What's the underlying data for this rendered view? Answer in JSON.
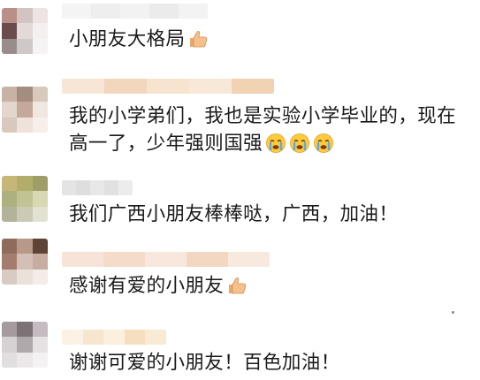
{
  "comments": [
    {
      "text": "小朋友大格局",
      "emoji": "thumbs-up-icon",
      "avatar_colors": [
        "#b98f87",
        "#d3c3c1",
        "#ece5e3",
        "#6a4c4c",
        "#e2d9d8",
        "#f3f0ef",
        "#9a8c8c",
        "#cfc8c8",
        "#f5f3f3"
      ],
      "name_colors": [
        "#f4f4f4",
        "#eeeeee",
        "#f2f2f2",
        "#ebebeb",
        "#f3f3f3"
      ]
    },
    {
      "text_line1": "我的小学弟们，我也是实验小学毕业的，现在",
      "text_line2": "高一了，少年强则国强",
      "emoji": "crying-face-icon",
      "avatar_colors": [
        "#c8b2a5",
        "#a48c80",
        "#d9c8bc",
        "#e5d6cd",
        "#c4a99a",
        "#f1e7e1",
        "#d8c8be",
        "#eee2da",
        "#f6efea"
      ],
      "name_colors": [
        "#f7e6d6",
        "#f2d7bc",
        "#f6e4cf",
        "#f8e8d8",
        "#f1d3b4"
      ]
    },
    {
      "text": "我们广西小朋友棒棒哒，广西，加油！",
      "avatar_colors": [
        "#c6b779",
        "#b3ad6b",
        "#9d9e68",
        "#aeb07d",
        "#c1c394",
        "#d8d8b2",
        "#b4b39a",
        "#cbcab4",
        "#e3e2d2"
      ],
      "name_colors": [
        "#e4e4e4",
        "#dedede",
        "#e8e8e8",
        "#e1e1e1",
        "#ececec"
      ]
    },
    {
      "text": "感谢有爱的小朋友",
      "emoji": "thumbs-up-icon",
      "avatar_colors": [
        "#8f6b5c",
        "#b89988",
        "#5e4436",
        "#a37e6f",
        "#d3bfb5",
        "#c7aea0",
        "#d9cbc3",
        "#ebe1db",
        "#f3ece8"
      ],
      "name_colors": [
        "#f7e3d8",
        "#f5dcc9",
        "#f8e7dc",
        "#f4d7c3",
        "#f8e9de"
      ]
    },
    {
      "text": "谢谢可爱的小朋友！百色加油！",
      "avatar_colors": [
        "#a59b9f",
        "#7c7377",
        "#c4bcc0",
        "#d7d1d4",
        "#b1a8ac",
        "#e6e2e4",
        "#e2dee0",
        "#ece8ea",
        "#f4f2f3"
      ],
      "name_colors": [
        "#fbf1e4",
        "#f7e6cf",
        "#fcefdd",
        "#f5dfc0",
        "#f9ead3"
      ]
    }
  ]
}
